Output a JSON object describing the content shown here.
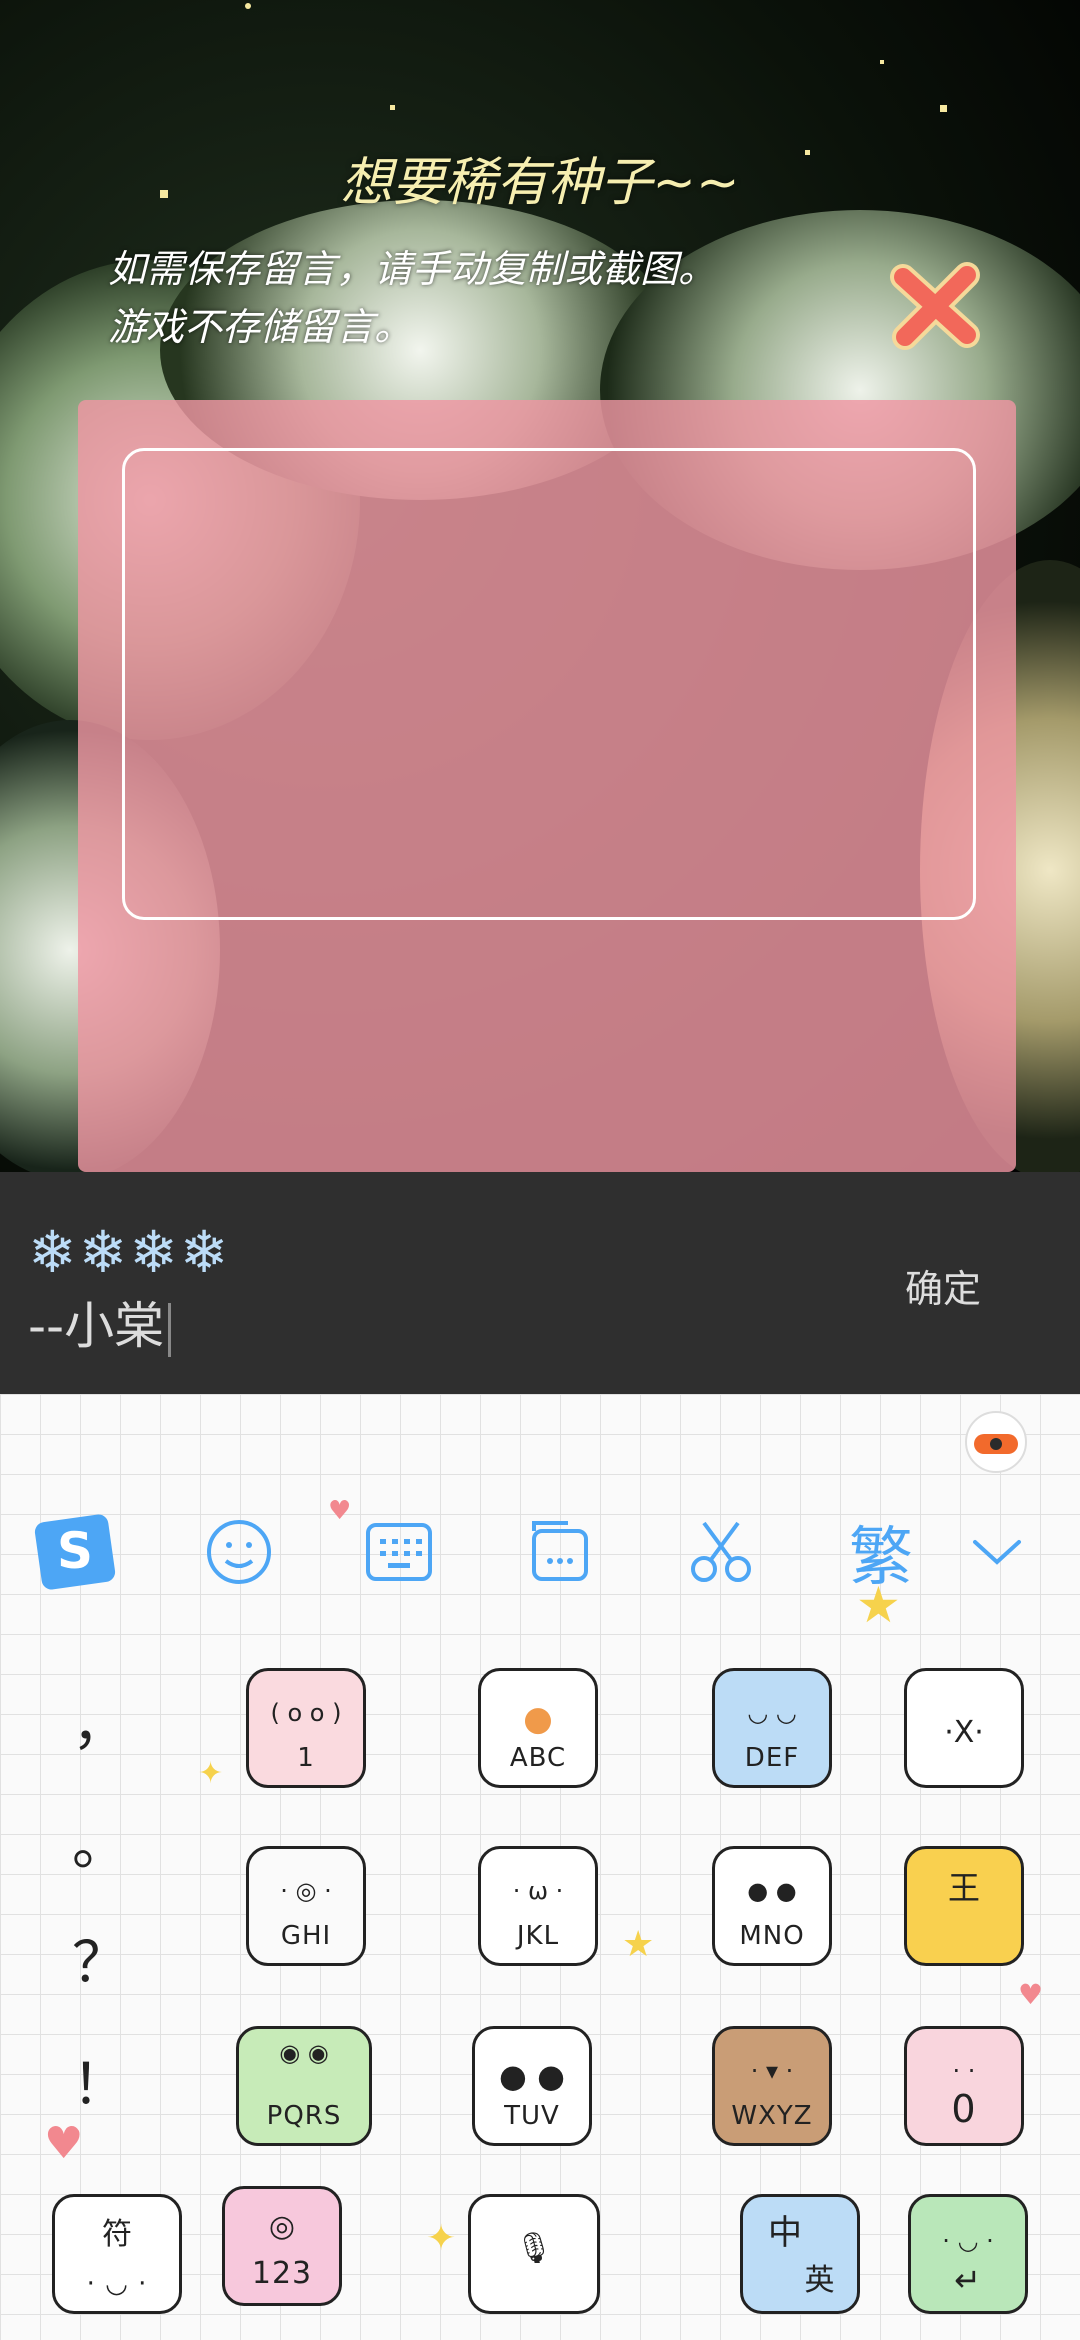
{
  "dialog": {
    "title": "想要稀有种子~~",
    "notice": "如需保存留言，请手动复制或截图。\n游戏不存储留言。"
  },
  "input": {
    "decoration": "❄❄❄❄",
    "text": "--小棠",
    "confirm_label": "确定"
  },
  "keyboard": {
    "toolbar": {
      "items": [
        "sogou-logo-icon",
        "emoji-icon",
        "keyboard-icon",
        "clipboard-icon",
        "scissors-icon",
        "traditional-toggle",
        "collapse-icon"
      ],
      "traditional_label": "繁"
    },
    "punctuation": [
      "，",
      "。",
      "？",
      "！"
    ],
    "keys": [
      {
        "label": "1",
        "animal": "pig"
      },
      {
        "label": "ABC",
        "animal": "duck"
      },
      {
        "label": "DEF",
        "animal": "penguin"
      },
      {
        "label": "",
        "animal": "husky",
        "face": "·X·"
      },
      {
        "label": "GHI",
        "animal": "hamster"
      },
      {
        "label": "JKL",
        "animal": "cat"
      },
      {
        "label": "MNO",
        "animal": "raccoon"
      },
      {
        "label": "",
        "animal": "tiger",
        "face": "王"
      },
      {
        "label": "PQRS",
        "animal": "frog"
      },
      {
        "label": "TUV",
        "animal": "panda"
      },
      {
        "label": "WXYZ",
        "animal": "bear"
      },
      {
        "label": "0",
        "animal": "pink-pig"
      }
    ],
    "bottom": {
      "symbols_label": "符",
      "numbers_label": "123",
      "lang_cn": "中",
      "lang_en": "英"
    }
  },
  "colors": {
    "card": "#ee96a2",
    "input_bar": "#2f2f2f",
    "accent_blue": "#4da6f5",
    "close_red": "#f2685a"
  }
}
